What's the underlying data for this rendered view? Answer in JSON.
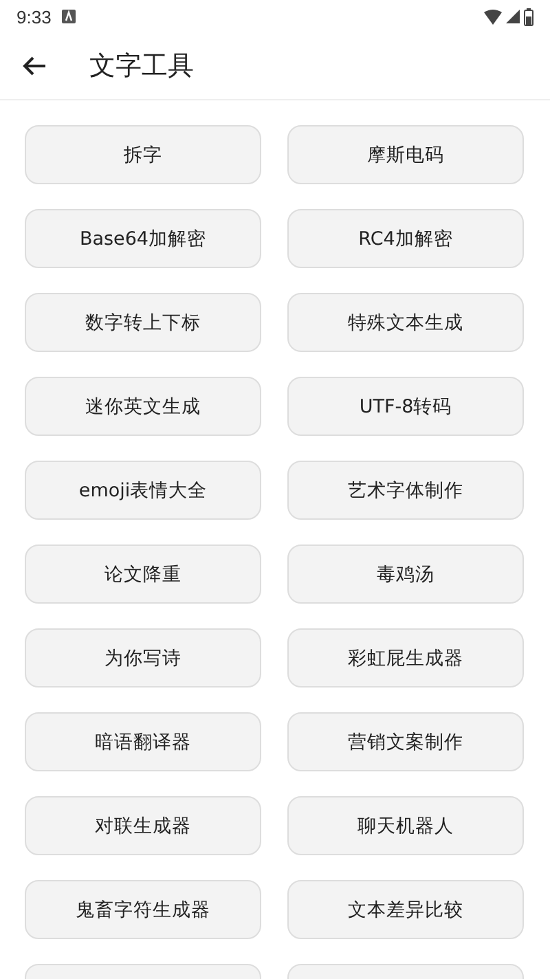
{
  "status_bar": {
    "time": "9:33"
  },
  "app_bar": {
    "title": "文字工具"
  },
  "tools": [
    {
      "label": "拆字"
    },
    {
      "label": "摩斯电码"
    },
    {
      "label": "Base64加解密"
    },
    {
      "label": "RC4加解密"
    },
    {
      "label": "数字转上下标"
    },
    {
      "label": "特殊文本生成"
    },
    {
      "label": "迷你英文生成"
    },
    {
      "label": "UTF-8转码"
    },
    {
      "label": "emoji表情大全"
    },
    {
      "label": "艺术字体制作"
    },
    {
      "label": "论文降重"
    },
    {
      "label": "毒鸡汤"
    },
    {
      "label": "为你写诗"
    },
    {
      "label": "彩虹屁生成器"
    },
    {
      "label": "暗语翻译器"
    },
    {
      "label": "营销文案制作"
    },
    {
      "label": "对联生成器"
    },
    {
      "label": "聊天机器人"
    },
    {
      "label": "鬼畜字符生成器"
    },
    {
      "label": "文本差异比较"
    }
  ],
  "cut_off_tools": [
    {
      "kind": "button"
    },
    {
      "kind": "button"
    }
  ]
}
